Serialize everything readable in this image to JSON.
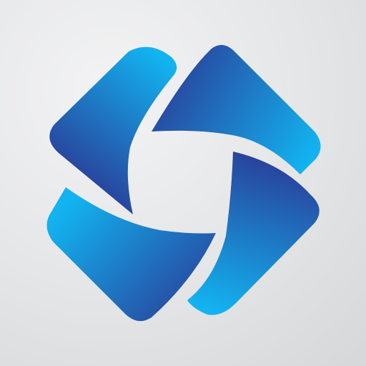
{
  "logo": {
    "icon": "pinwheel-logo-icon",
    "colors": {
      "light": "#12b3f0",
      "dark": "#2a3e98",
      "background": "#e4e5e7"
    }
  }
}
